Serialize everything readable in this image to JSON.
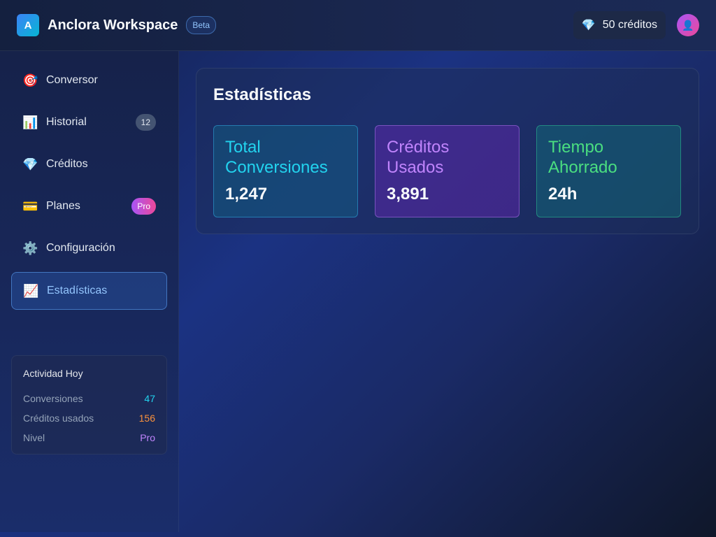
{
  "header": {
    "logo_letter": "A",
    "app_title": "Anclora Workspace",
    "badge": "Beta",
    "credits_icon": "gem-icon",
    "credits_label": "50 créditos",
    "avatar_icon": "user-icon"
  },
  "sidebar": {
    "items": [
      {
        "icon": "target-icon",
        "label": "Conversor",
        "badge": ""
      },
      {
        "icon": "bar-chart-icon",
        "label": "Historial",
        "badge": "12"
      },
      {
        "icon": "gem-icon",
        "label": "Créditos",
        "badge": ""
      },
      {
        "icon": "credit-card-icon",
        "label": "Planes",
        "badge": "Pro"
      },
      {
        "icon": "gear-icon",
        "label": "Configuración",
        "badge": ""
      },
      {
        "icon": "trend-chart-icon",
        "label": "Estadísticas",
        "badge": "",
        "active": true
      }
    ],
    "activity": {
      "title": "Actividad Hoy",
      "rows": [
        {
          "label": "Conversiones",
          "value": "47",
          "color": "#22d3ee"
        },
        {
          "label": "Créditos usados",
          "value": "156",
          "color": "#fb923c"
        },
        {
          "label": "Nivel",
          "value": "Pro",
          "color": "#c084fc"
        }
      ]
    }
  },
  "main": {
    "title": "Estadísticas",
    "cards": [
      {
        "label": "Total Conversiones",
        "value": "1,247",
        "color": "#22d3ee"
      },
      {
        "label": "Créditos Usados",
        "value": "3,891",
        "color": "#c084fc"
      },
      {
        "label": "Tiempo Ahorrado",
        "value": "24h",
        "color": "#4ade80"
      }
    ]
  }
}
